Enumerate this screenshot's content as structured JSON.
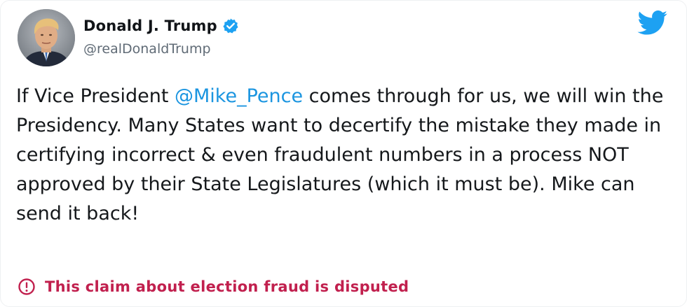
{
  "author": {
    "display_name": "Donald J. Trump",
    "handle": "@realDonaldTrump",
    "verified": true
  },
  "tweet": {
    "text_before_mention": "If Vice President ",
    "mention": "@Mike_Pence",
    "text_after_mention": " comes through for us, we will win the Presidency. Many States want to decertify the mistake they made in certifying incorrect & even fraudulent numbers in a process NOT approved by their State Legislatures (which it must be). Mike can send it back!"
  },
  "label": {
    "icon": "alert-circle-icon",
    "text": "This claim about election fraud is disputed"
  },
  "icons": {
    "brand": "twitter-bird-icon",
    "verified": "verified-badge-icon"
  },
  "colors": {
    "link": "#1b95e0",
    "brand": "#1da1f2",
    "warning": "#c1204e",
    "text": "#15181b",
    "muted": "#606b76"
  }
}
